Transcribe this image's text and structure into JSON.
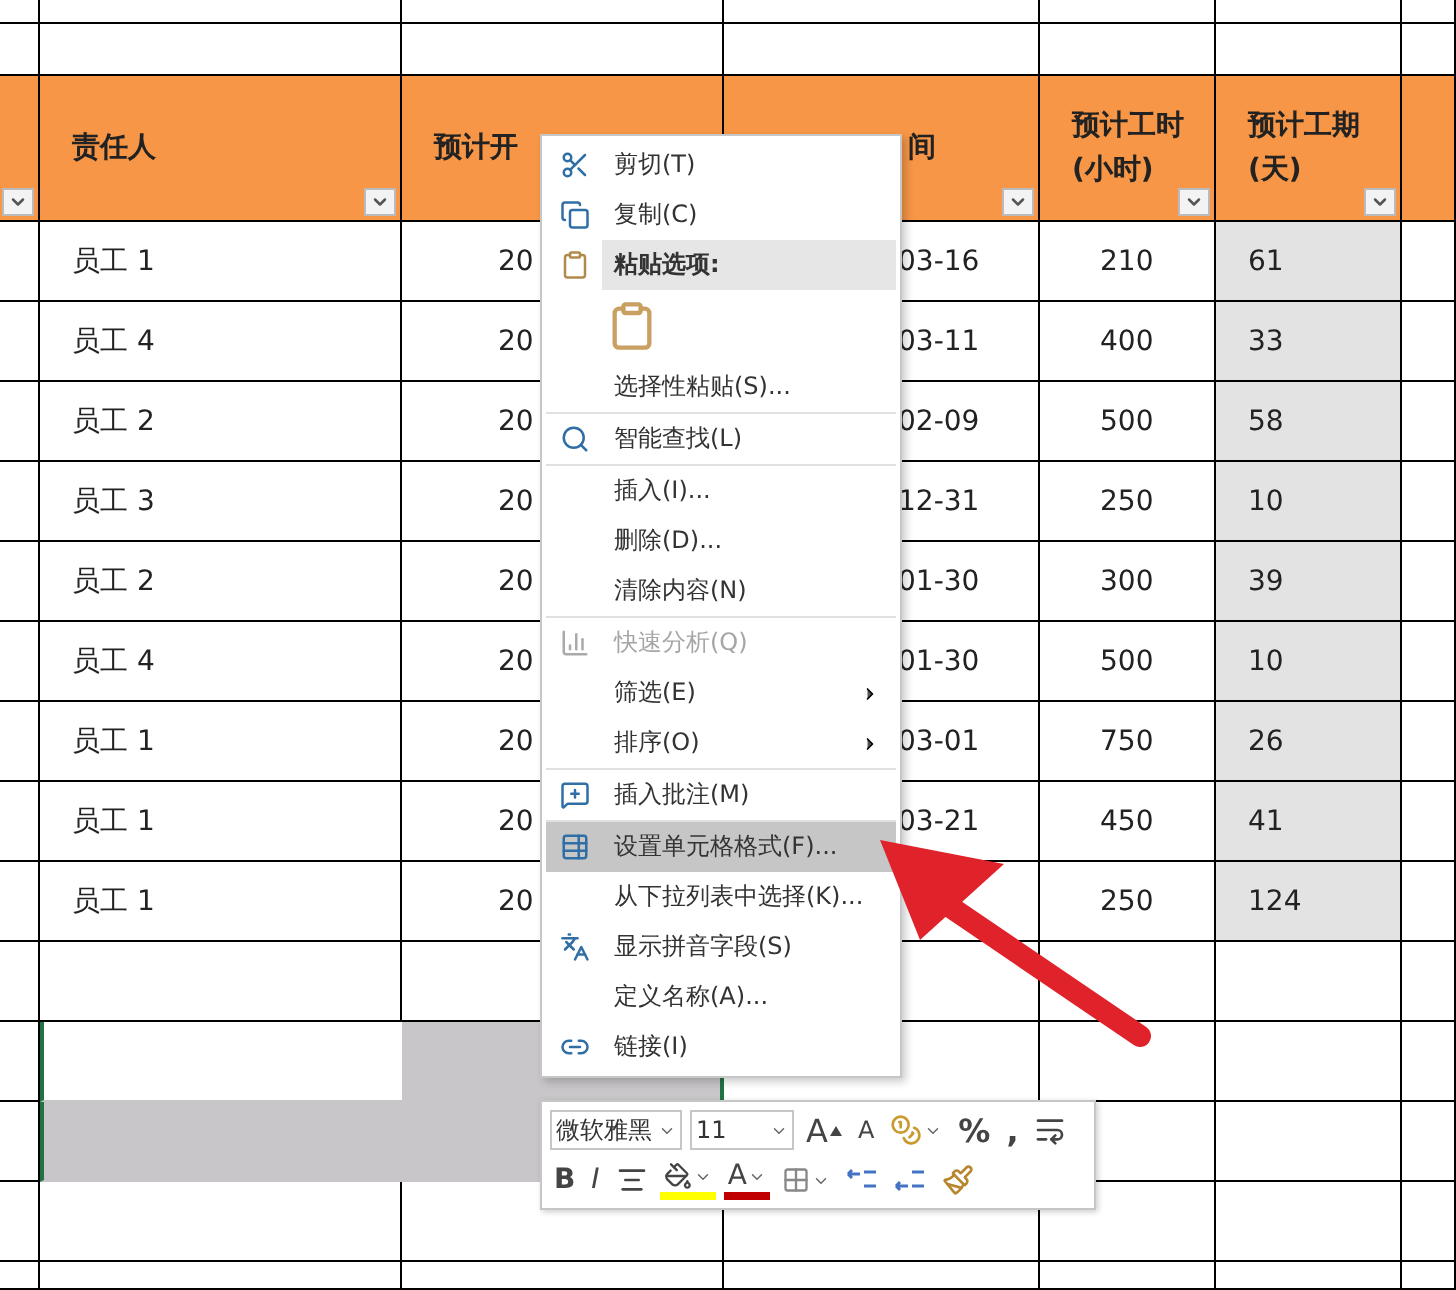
{
  "sheet": {
    "header": [
      {
        "filter": true
      },
      {
        "label": "责任人",
        "filter": true
      },
      {
        "label": "预计开"
      },
      {
        "label": "间",
        "filter": true
      },
      {
        "label": "预计工时\n(小时)",
        "filter": true
      },
      {
        "label": "预计工期\n(天)",
        "filter": true
      }
    ],
    "rows": [
      {
        "cells": [
          "",
          "员工 1",
          "20",
          "03-16",
          "210",
          "61",
          ""
        ]
      },
      {
        "cells": [
          "",
          "员工 4",
          "20",
          "03-11",
          "400",
          "33",
          ""
        ]
      },
      {
        "cells": [
          "",
          "员工 2",
          "20",
          "02-09",
          "500",
          "58",
          ""
        ]
      },
      {
        "cells": [
          "",
          "员工 3",
          "20",
          "12-31",
          "250",
          "10",
          ""
        ]
      },
      {
        "cells": [
          "",
          "员工 2",
          "20",
          "01-30",
          "300",
          "39",
          ""
        ]
      },
      {
        "cells": [
          "",
          "员工 4",
          "20",
          "01-30",
          "500",
          "10",
          ""
        ]
      },
      {
        "cells": [
          "",
          "员工 1",
          "20",
          "03-01",
          "750",
          "26",
          ""
        ]
      },
      {
        "cells": [
          "",
          "员工 1",
          "20",
          "03-21",
          "450",
          "41",
          ""
        ]
      },
      {
        "cells": [
          "",
          "员工 1",
          "20",
          "",
          "250",
          "124",
          ""
        ]
      }
    ],
    "empty_rows": [
      {
        "selected": false
      },
      {
        "selected": true
      },
      {
        "selected": true
      },
      {
        "selected": false
      }
    ]
  },
  "context_menu": {
    "items": [
      {
        "kind": "item",
        "label": "剪切(T)",
        "disabled": false,
        "selected": false,
        "submenu": false,
        "separator": false
      },
      {
        "kind": "item",
        "label": "复制(C)",
        "disabled": false,
        "selected": false,
        "submenu": false,
        "separator": false
      },
      {
        "kind": "header",
        "label": "粘贴选项:"
      },
      {
        "kind": "paste-options"
      },
      {
        "kind": "item",
        "label": "选择性粘贴(S)...",
        "disabled": false,
        "selected": false,
        "submenu": false,
        "separator": false
      },
      {
        "kind": "item",
        "label": "智能查找(L)",
        "disabled": false,
        "selected": false,
        "submenu": false,
        "separator": true
      },
      {
        "kind": "item",
        "label": "插入(I)...",
        "disabled": false,
        "selected": false,
        "submenu": false,
        "separator": true
      },
      {
        "kind": "item",
        "label": "删除(D)...",
        "disabled": false,
        "selected": false,
        "submenu": false,
        "separator": false
      },
      {
        "kind": "item",
        "label": "清除内容(N)",
        "disabled": false,
        "selected": false,
        "submenu": false,
        "separator": false
      },
      {
        "kind": "item",
        "label": "快速分析(Q)",
        "disabled": true,
        "selected": false,
        "submenu": false,
        "separator": true
      },
      {
        "kind": "item",
        "label": "筛选(E)",
        "disabled": false,
        "selected": false,
        "submenu": true,
        "separator": false
      },
      {
        "kind": "item",
        "label": "排序(O)",
        "disabled": false,
        "selected": false,
        "submenu": true,
        "separator": false
      },
      {
        "kind": "item",
        "label": "插入批注(M)",
        "disabled": false,
        "selected": false,
        "submenu": false,
        "separator": true
      },
      {
        "kind": "item",
        "label": "设置单元格格式(F)...",
        "disabled": false,
        "selected": true,
        "submenu": false,
        "separator": true
      },
      {
        "kind": "item",
        "label": "从下拉列表中选择(K)...",
        "disabled": false,
        "selected": false,
        "submenu": false,
        "separator": false
      },
      {
        "kind": "item",
        "label": "显示拼音字段(S)",
        "disabled": false,
        "selected": false,
        "submenu": false,
        "separator": false
      },
      {
        "kind": "item",
        "label": "定义名称(A)...",
        "disabled": false,
        "selected": false,
        "submenu": false,
        "separator": false
      },
      {
        "kind": "item",
        "label": "链接(I)",
        "disabled": false,
        "selected": false,
        "submenu": false,
        "separator": false
      }
    ]
  },
  "mini_toolbar": {
    "font_name": "微软雅黑",
    "font_size": "11",
    "row1": [
      {
        "kind": "grow",
        "label": "A"
      },
      {
        "kind": "shrink",
        "label": "A"
      },
      {
        "kind": "accounting"
      },
      {
        "kind": "text",
        "label": "%"
      },
      {
        "kind": "text",
        "label": ","
      },
      {
        "kind": "wrap"
      }
    ],
    "row2": [
      {
        "kind": "bold",
        "label": "B"
      },
      {
        "kind": "italic",
        "label": "I"
      },
      {
        "kind": "align"
      },
      {
        "kind": "fill",
        "color": "#ffff00"
      },
      {
        "kind": "font-color",
        "label": "A",
        "color": "#c00000"
      },
      {
        "kind": "borders"
      },
      {
        "kind": "inc-decimal"
      },
      {
        "kind": "dec-decimal"
      },
      {
        "kind": "painter"
      }
    ]
  }
}
